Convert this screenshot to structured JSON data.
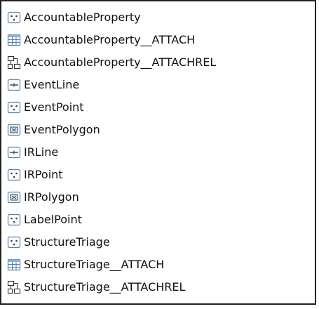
{
  "items": [
    {
      "label": "AccountableProperty",
      "icon": "point-feature-class-icon"
    },
    {
      "label": "AccountableProperty__ATTACH",
      "icon": "table-icon"
    },
    {
      "label": "AccountableProperty__ATTACHREL",
      "icon": "relationship-class-icon"
    },
    {
      "label": "EventLine",
      "icon": "line-feature-class-icon"
    },
    {
      "label": "EventPoint",
      "icon": "point-feature-class-icon"
    },
    {
      "label": "EventPolygon",
      "icon": "polygon-feature-class-icon"
    },
    {
      "label": "IRLine",
      "icon": "line-feature-class-icon"
    },
    {
      "label": "IRPoint",
      "icon": "point-feature-class-icon"
    },
    {
      "label": "IRPolygon",
      "icon": "polygon-feature-class-icon"
    },
    {
      "label": "LabelPoint",
      "icon": "point-feature-class-icon"
    },
    {
      "label": "StructureTriage",
      "icon": "point-feature-class-icon"
    },
    {
      "label": "StructureTriage__ATTACH",
      "icon": "table-icon"
    },
    {
      "label": "StructureTriage__ATTACHREL",
      "icon": "relationship-class-icon"
    }
  ],
  "colors": {
    "icon_stroke": "#5a7fa8",
    "icon_fill": "#ffffff",
    "table_header": "#8fb0d8"
  }
}
